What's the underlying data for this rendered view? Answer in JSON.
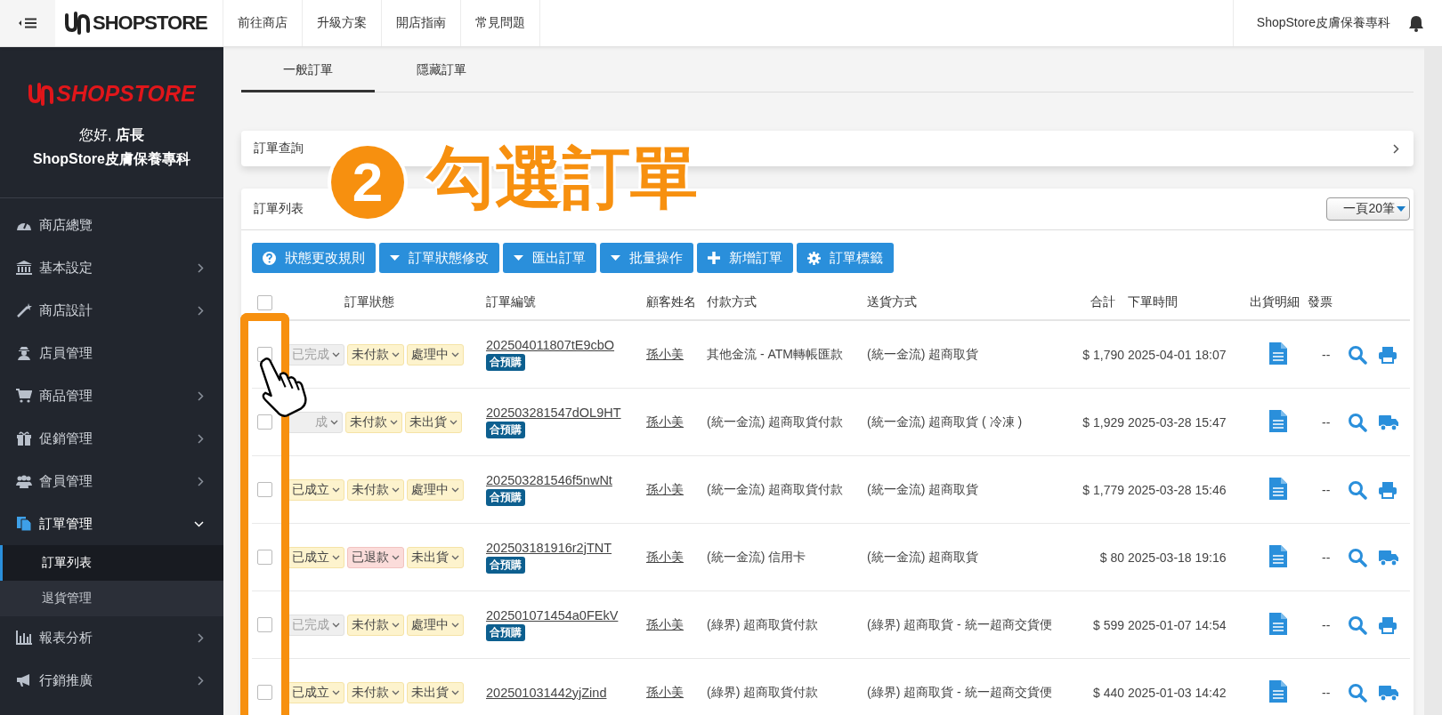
{
  "topbar": {
    "logo": "SHOPSTORE",
    "nav": [
      "前往商店",
      "升級方案",
      "開店指南",
      "常見問題"
    ],
    "store_name": "ShopStore皮膚保養專科"
  },
  "sidebar": {
    "logo": "SHOPSTORE",
    "greeting": "您好, **店長**",
    "store_name": "ShopStore皮膚保養專科",
    "items": [
      {
        "label": "商店總覽",
        "has_submenu": false,
        "selected": false
      },
      {
        "label": "基本設定",
        "has_submenu": true,
        "expanded": false,
        "selected": false
      },
      {
        "label": "商店設計",
        "has_submenu": true,
        "expanded": false,
        "selected": false
      },
      {
        "label": "店員管理",
        "has_submenu": false,
        "selected": false
      },
      {
        "label": "商品管理",
        "has_submenu": true,
        "expanded": false,
        "selected": false
      },
      {
        "label": "促銷管理",
        "has_submenu": true,
        "expanded": false,
        "selected": false
      },
      {
        "label": "會員管理",
        "has_submenu": true,
        "expanded": false,
        "selected": false
      },
      {
        "label": "訂單管理",
        "has_submenu": true,
        "expanded": true,
        "selected": true,
        "children": [
          {
            "label": "訂單列表",
            "selected": true
          },
          {
            "label": "退貨管理",
            "selected": false
          }
        ]
      },
      {
        "label": "報表分析",
        "has_submenu": true,
        "expanded": false,
        "selected": false
      },
      {
        "label": "行銷推廣",
        "has_submenu": true,
        "expanded": false,
        "selected": false
      }
    ]
  },
  "tabs": [
    {
      "label": "一般訂單",
      "selected": true
    },
    {
      "label": "隱藏訂單",
      "selected": false
    }
  ],
  "query_panel": {
    "title": "訂單查詢",
    "expanded": false
  },
  "order_list": {
    "title": "訂單列表",
    "page_size": "一頁20筆",
    "buttons": [
      {
        "label": "狀態更改規則",
        "kind": "help"
      },
      {
        "label": "訂單狀態修改",
        "kind": "dropdown"
      },
      {
        "label": "匯出訂單",
        "kind": "dropdown"
      },
      {
        "label": "批量操作",
        "kind": "dropdown"
      },
      {
        "label": "新增訂單",
        "kind": "add"
      },
      {
        "label": "訂單標籤",
        "kind": "settings"
      }
    ],
    "select_all_checked": false,
    "columns": [
      "訂單狀態",
      "訂單編號",
      "顧客姓名",
      "付款方式",
      "送貨方式",
      "合計",
      "下單時間",
      "出貨明細",
      "發票"
    ],
    "rows": [
      {
        "checked": false,
        "statuses": [
          {
            "text": "已完成",
            "kind": "done"
          },
          {
            "text": "未付款",
            "kind": "pending"
          },
          {
            "text": "處理中",
            "kind": "pending"
          }
        ],
        "order_no": "202504011807tE9cbO",
        "tag": "合預購",
        "customer": "孫小美",
        "payment": "其他金流 - ATM轉帳匯款",
        "shipping": "(統一金流) 超商取貨",
        "total": "$ 1,790",
        "time": "2025-04-01 18:07",
        "invoice": "--",
        "kind": "print"
      },
      {
        "checked": false,
        "statuses": [
          {
            "text": "成",
            "kind": "done"
          },
          {
            "text": "未付款",
            "kind": "pending"
          },
          {
            "text": "未出貨",
            "kind": "pending"
          }
        ],
        "order_no": "202503281547dOL9HT",
        "tag": "合預購",
        "customer": "孫小美",
        "payment": "(統一金流) 超商取貨付款",
        "shipping": "(統一金流) 超商取貨 ( 冷凍 )",
        "total": "$ 1,929",
        "time": "2025-03-28 15:47",
        "invoice": "--",
        "kind": "ship"
      },
      {
        "checked": false,
        "statuses": [
          {
            "text": "已成立",
            "kind": "pending"
          },
          {
            "text": "未付款",
            "kind": "pending"
          },
          {
            "text": "處理中",
            "kind": "pending"
          }
        ],
        "order_no": "202503281546f5nwNt",
        "tag": "合預購",
        "customer": "孫小美",
        "payment": "(統一金流) 超商取貨付款",
        "shipping": "(統一金流) 超商取貨",
        "total": "$ 1,779",
        "time": "2025-03-28 15:46",
        "invoice": "--",
        "kind": "print"
      },
      {
        "checked": false,
        "statuses": [
          {
            "text": "已成立",
            "kind": "pending"
          },
          {
            "text": "已退款",
            "kind": "refunded"
          },
          {
            "text": "未出貨",
            "kind": "pending"
          }
        ],
        "order_no": "202503181916r2jTNT",
        "tag": "合預購",
        "customer": "孫小美",
        "payment": "(統一金流) 信用卡",
        "shipping": "(統一金流) 超商取貨",
        "total": "$ 80",
        "time": "2025-03-18 19:16",
        "invoice": "--",
        "kind": "ship"
      },
      {
        "checked": false,
        "statuses": [
          {
            "text": "已完成",
            "kind": "done"
          },
          {
            "text": "未付款",
            "kind": "pending"
          },
          {
            "text": "處理中",
            "kind": "pending"
          }
        ],
        "order_no": "202501071454a0FEkV",
        "tag": "合預購",
        "customer": "孫小美",
        "payment": "(綠界) 超商取貨付款",
        "shipping": "(綠界) 超商取貨 - 統一超商交貨便",
        "total": "$ 599",
        "time": "2025-01-07 14:54",
        "invoice": "--",
        "kind": "print"
      },
      {
        "checked": false,
        "statuses": [
          {
            "text": "已成立",
            "kind": "pending"
          },
          {
            "text": "未付款",
            "kind": "pending"
          },
          {
            "text": "未出貨",
            "kind": "pending"
          }
        ],
        "order_no": "202501031442yjZind",
        "customer": "孫小美",
        "payment": "(綠界) 超商取貨付款",
        "shipping": "(綠界) 超商取貨 - 統一超商交貨便",
        "total": "$ 440",
        "time": "2025-01-03 14:42",
        "invoice": "--",
        "kind": "ship"
      }
    ]
  },
  "annotation": {
    "step": "2",
    "text": "勾選訂單"
  }
}
